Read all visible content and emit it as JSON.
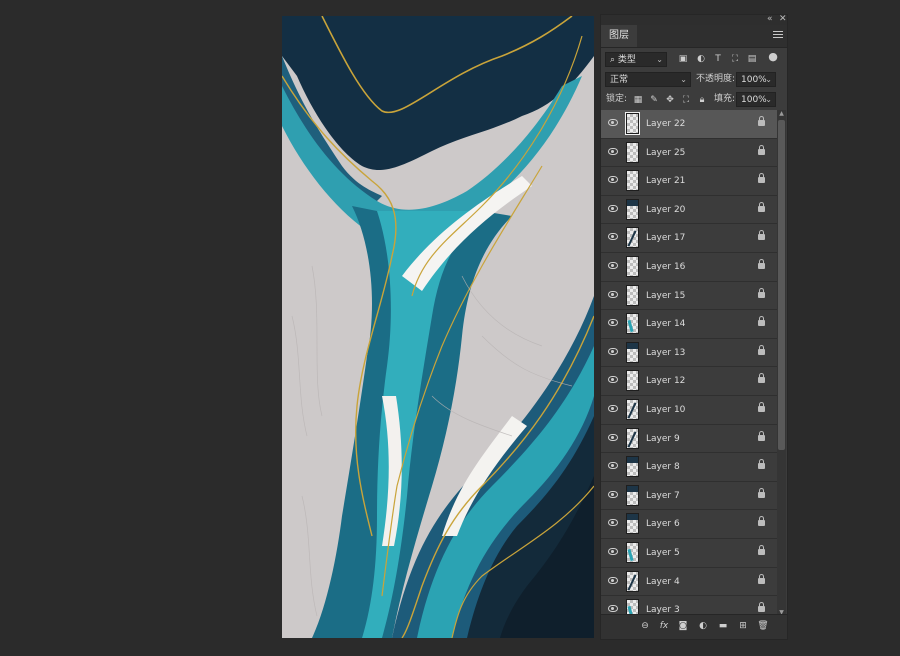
{
  "panel": {
    "tab_title": "图层",
    "filter_kind": "类型",
    "blend_mode": "正常",
    "opacity_label": "不透明度:",
    "opacity_value": "100%",
    "lock_label": "锁定:",
    "fill_label": "填充:",
    "fill_value": "100%",
    "collapse_icon": "double-chevron-icon",
    "close_icon": "close-icon"
  },
  "layers": [
    {
      "name": "Layer 22",
      "selected": true
    },
    {
      "name": "Layer 25",
      "selected": false
    },
    {
      "name": "Layer 21",
      "selected": false
    },
    {
      "name": "Layer 20",
      "selected": false
    },
    {
      "name": "Layer 17",
      "selected": false
    },
    {
      "name": "Layer 16",
      "selected": false
    },
    {
      "name": "Layer 15",
      "selected": false
    },
    {
      "name": "Layer 14",
      "selected": false
    },
    {
      "name": "Layer 13",
      "selected": false
    },
    {
      "name": "Layer 12",
      "selected": false
    },
    {
      "name": "Layer 10",
      "selected": false
    },
    {
      "name": "Layer 9",
      "selected": false
    },
    {
      "name": "Layer 8",
      "selected": false
    },
    {
      "name": "Layer 7",
      "selected": false
    },
    {
      "name": "Layer 6",
      "selected": false
    },
    {
      "name": "Layer 5",
      "selected": false
    },
    {
      "name": "Layer 4",
      "selected": false
    },
    {
      "name": "Layer 3",
      "selected": false
    }
  ],
  "footer_icons": [
    "link-icon",
    "fx-icon",
    "mask-icon",
    "adjustment-icon",
    "folder-icon",
    "new-layer-icon",
    "trash-icon"
  ],
  "colors": {
    "background": "#2b2b2b",
    "panel": "#3c3c3c",
    "selected_row": "#575757",
    "art_navy": "#163a52",
    "art_teal": "#2b9fae",
    "art_gold": "#c9a43a",
    "art_grey": "#cfcbcb"
  }
}
